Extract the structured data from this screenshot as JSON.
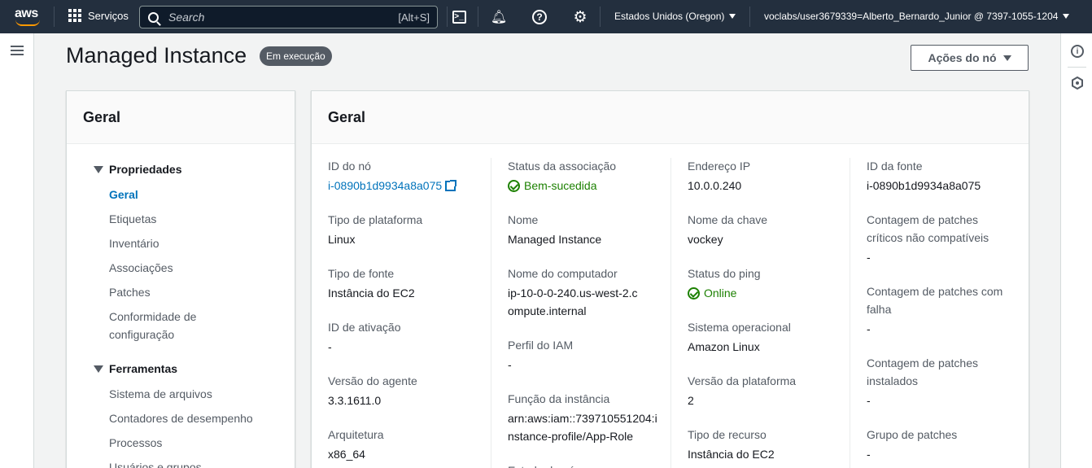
{
  "topnav": {
    "logo_text": "aws",
    "services_label": "Serviços",
    "search_placeholder": "Search",
    "search_shortcut": "[Alt+S]",
    "region": "Estados Unidos (Oregon)",
    "account": "voclabs/user3679339=Alberto_Bernardo_Junior @ 7397-1055-1204"
  },
  "header": {
    "title": "Managed Instance",
    "status_badge": "Em execução",
    "actions_label": "Ações do nó"
  },
  "left_panel": {
    "title": "Geral",
    "groups": [
      {
        "label": "Propriedades",
        "items": [
          "Geral",
          "Etiquetas",
          "Inventário",
          "Associações",
          "Patches",
          "Conformidade de configuração"
        ]
      },
      {
        "label": "Ferramentas",
        "items": [
          "Sistema de arquivos",
          "Contadores de desempenho",
          "Processos",
          "Usuários e grupos"
        ]
      }
    ],
    "active_item": "Geral"
  },
  "details": {
    "title": "Geral",
    "col1": [
      {
        "label": "ID do nó",
        "value": "i-0890b1d9934a8a075"
      },
      {
        "label": "Tipo de plataforma",
        "value": "Linux"
      },
      {
        "label": "Tipo de fonte",
        "value": "Instância do EC2"
      },
      {
        "label": "ID de ativação",
        "value": "-"
      },
      {
        "label": "Versão do agente",
        "value": "3.3.1611.0"
      },
      {
        "label": "Arquitetura",
        "value": "x86_64"
      }
    ],
    "col2": [
      {
        "label": "Status da associação",
        "value": "Bem-sucedida"
      },
      {
        "label": "Nome",
        "value": "Managed Instance"
      },
      {
        "label": "Nome do computador",
        "value": "ip-10-0-0-240.us-west-2.compute.internal"
      },
      {
        "label": "Perfil do IAM",
        "value": "-"
      },
      {
        "label": "Função da instância",
        "value": "arn:aws:iam::739710551204:instance-profile/App-Role"
      },
      {
        "label": "Estado do nó",
        "value": ""
      }
    ],
    "col3": [
      {
        "label": "Endereço IP",
        "value": "10.0.0.240"
      },
      {
        "label": "Nome da chave",
        "value": "vockey"
      },
      {
        "label": "Status do ping",
        "value": "Online"
      },
      {
        "label": "Sistema operacional",
        "value": "Amazon Linux"
      },
      {
        "label": "Versão da plataforma",
        "value": "2"
      },
      {
        "label": "Tipo de recurso",
        "value": "Instância do EC2"
      }
    ],
    "col4": [
      {
        "label": "ID da fonte",
        "value": "i-0890b1d9934a8a075"
      },
      {
        "label": "Contagem de patches críticos não compatíveis",
        "value": "-"
      },
      {
        "label": "Contagem de patches com falha",
        "value": "-"
      },
      {
        "label": "Contagem de patches instalados",
        "value": "-"
      },
      {
        "label": "Grupo de patches",
        "value": "-"
      }
    ]
  },
  "colors": {
    "nav_bg": "#232f3e",
    "link": "#0073bb",
    "success": "#1d8102",
    "badge_bg": "#545b64"
  }
}
